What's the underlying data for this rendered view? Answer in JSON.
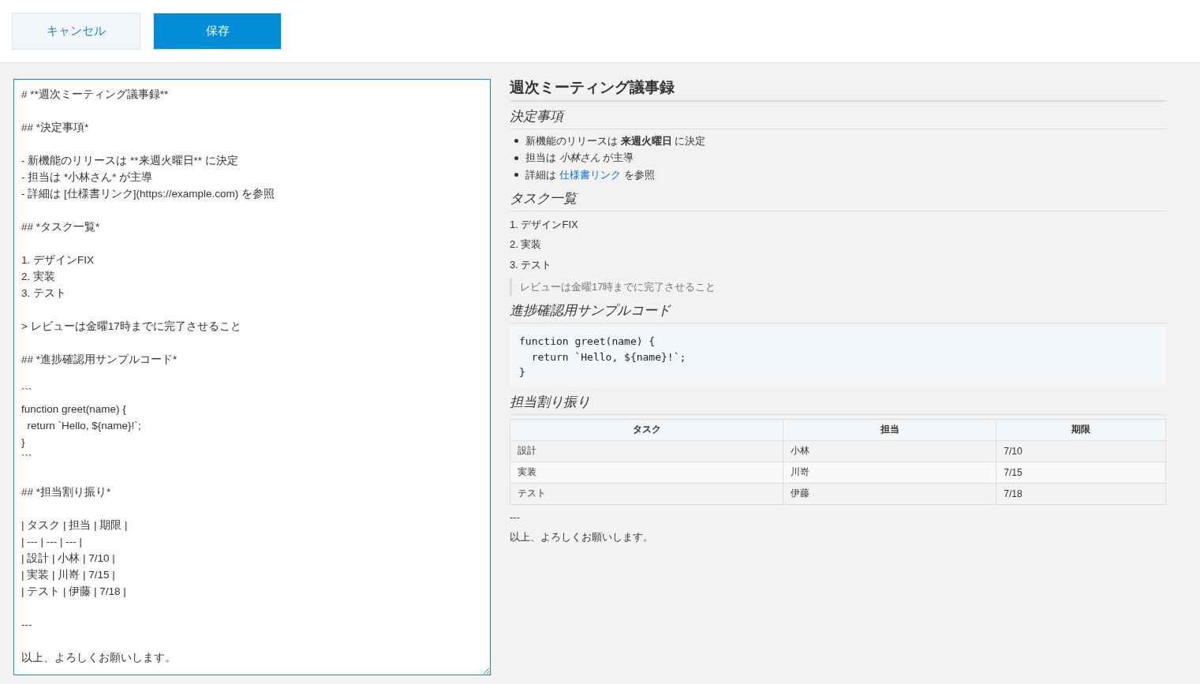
{
  "toolbar": {
    "buttons": [
      {
        "label": "キャンセル",
        "kind": "secondary"
      },
      {
        "label": "保存",
        "kind": "primary"
      }
    ]
  },
  "editor": {
    "value": "# **週次ミーティング議事録**\n\n## *決定事項*\n\n- 新機能のリリースは **来週火曜日** に決定\n- 担当は *小林さん* が主導\n- 詳細は [仕様書リンク](https://example.com) を参照\n\n## *タスク一覧*\n\n1. デザインFIX\n2. 実装\n3. テスト\n\n> レビューは金曜17時までに完了させること\n\n## *進捗確認用サンプルコード*\n\n```\nfunction greet(name) {\n  return `Hello, ${name}!`;\n}\n```\n\n## *担当割り振り*\n\n| タスク | 担当 | 期限 |\n| --- | --- | --- |\n| 設計 | 小林 | 7/10 |\n| 実装 | 川嵜 | 7/15 |\n| テスト | 伊藤 | 7/18 |\n\n---\n\n以上、よろしくお願いします。"
  },
  "preview": {
    "blocks": [
      {
        "kind": "title",
        "text": "週次ミーティング議事録"
      },
      {
        "kind": "heading",
        "text": "決定事項"
      },
      {
        "kind": "bullets",
        "items": [
          {
            "text": "新機能のリリースは **来週火曜日** に決定"
          },
          {
            "text": "担当は *小林さん* が主導"
          },
          {
            "text": "詳細は",
            "link": "仕様書リンク",
            "after": "を参照"
          }
        ]
      },
      {
        "kind": "heading",
        "text": "タスク一覧"
      },
      {
        "kind": "numbered",
        "items": [
          "1. デザインFIX",
          "2. 実装",
          "3. テスト"
        ]
      },
      {
        "kind": "quote",
        "text": "レビューは金曜17時までに完了させること"
      },
      {
        "kind": "heading",
        "text": "進捗確認用サンプルコード"
      },
      {
        "kind": "code",
        "text": "function greet(name) {\n  return `Hello, ${name}!`;\n}"
      },
      {
        "kind": "heading",
        "text": "担当割り振り"
      },
      {
        "kind": "table",
        "columns": [
          "タスク",
          "担当",
          "期限"
        ],
        "rows": [
          [
            "設計",
            "小林",
            "7/10"
          ],
          [
            "実装",
            "川嵜",
            "7/15"
          ],
          [
            "テスト",
            "伊藤",
            "7/18"
          ]
        ]
      },
      {
        "kind": "text",
        "text": "---"
      },
      {
        "kind": "text",
        "text": "以上、よろしくお願いします。"
      }
    ]
  }
}
